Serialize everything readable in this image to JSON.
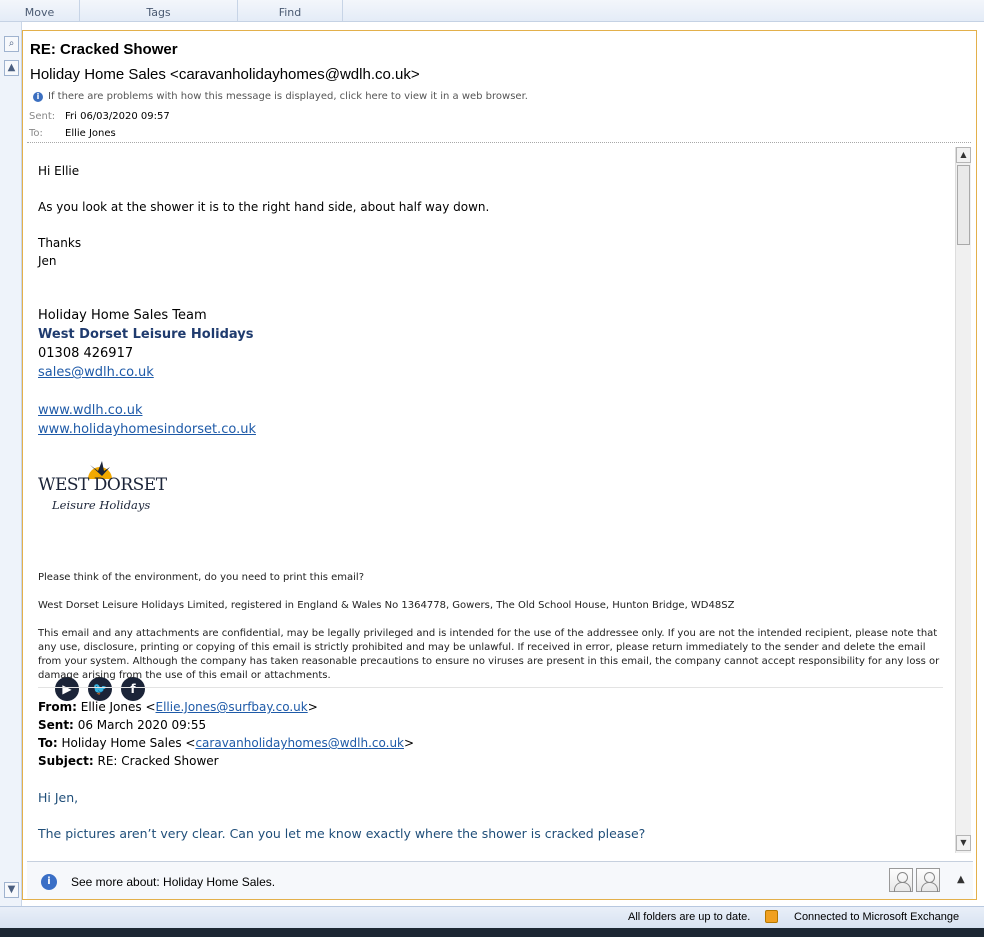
{
  "ribbon": {
    "groups": [
      "Move",
      "Tags",
      "Find"
    ]
  },
  "message": {
    "subject": "RE: Cracked Shower",
    "sender": "Holiday Home Sales <caravanholidayhomes@wdlh.co.uk>",
    "info": "If there are problems with how this message is displayed, click here to view it in a web browser.",
    "sent_label": "Sent:",
    "sent": "Fri 06/03/2020 09:57",
    "to_label": "To:",
    "to": "Ellie Jones"
  },
  "body": {
    "greeting": "Hi Ellie",
    "line1": "As you look at the shower it is to the right hand side, about half way down.",
    "thanks": "Thanks",
    "name": "Jen",
    "sig_team": "Holiday Home Sales Team",
    "sig_company": "West Dorset Leisure Holidays",
    "sig_phone": "01308 426917",
    "sig_email": "sales@wdlh.co.uk",
    "sig_web1": "www.wdlh.co.uk",
    "sig_web2": "www.holidayhomesindorset.co.uk",
    "logo_main": "WEST DORSET",
    "logo_sub": "Leisure Holidays",
    "env": "Please think of the environment, do you need to print this email?",
    "company_reg": "West Dorset Leisure Holidays Limited, registered in England & Wales No 1364778, Gowers, The Old School House, Hunton Bridge, WD48SZ",
    "disclaimer": "This email and any attachments are confidential, may be legally privileged and is intended for the use of the addressee only. If you are not the intended recipient, please note that any use, disclosure, printing or copying of this email is strictly prohibited and may be unlawful. If received in error, please return immediately to the sender and delete the email from your system. Although the company has taken reasonable precautions to ensure no viruses are present in this email, the company cannot accept responsibility for any loss or damage arising from the use of this email or attachments."
  },
  "quoted": {
    "from_label": "From:",
    "from_name": "Ellie Jones <",
    "from_email": "Ellie.Jones@surfbay.co.uk",
    "from_close": ">",
    "sent_label": "Sent:",
    "sent": "06 March 2020 09:55",
    "to_label": "To:",
    "to_name": "Holiday Home Sales <",
    "to_email": "caravanholidayhomes@wdlh.co.uk",
    "to_close": ">",
    "subject_label": "Subject:",
    "subject": "RE: Cracked Shower",
    "greeting": "Hi Jen,",
    "line1": "The pictures aren’t very clear. Can you let me know exactly where the shower is cracked please?"
  },
  "people_pane": {
    "text": "See more about: Holiday Home Sales."
  },
  "status": {
    "left": "All folders are up to date.",
    "right": "Connected to Microsoft Exchange"
  }
}
